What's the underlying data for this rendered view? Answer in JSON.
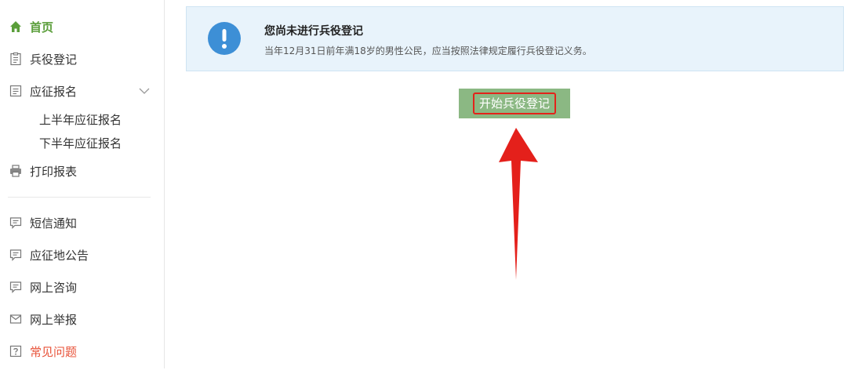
{
  "sidebar": {
    "items": [
      {
        "label": "首页",
        "icon": "home-icon"
      },
      {
        "label": "兵役登记",
        "icon": "clipboard-icon"
      },
      {
        "label": "应征报名",
        "icon": "form-icon"
      },
      {
        "label": "打印报表",
        "icon": "printer-icon"
      },
      {
        "label": "短信通知",
        "icon": "message-icon"
      },
      {
        "label": "应征地公告",
        "icon": "message-icon"
      },
      {
        "label": "网上咨询",
        "icon": "message-icon"
      },
      {
        "label": "网上举报",
        "icon": "mail-icon"
      },
      {
        "label": "常见问题",
        "icon": "question-icon"
      }
    ],
    "sub_items": [
      "上半年应征报名",
      "下半年应征报名"
    ]
  },
  "notice": {
    "title": "您尚未进行兵役登记",
    "desc": "当年12月31日前年满18岁的男性公民，应当按照法律规定履行兵役登记义务。"
  },
  "button": {
    "label": "开始兵役登记"
  },
  "colors": {
    "active": "#5a9e3a",
    "warn": "#e8533a",
    "button_bg": "#8bb883",
    "highlight": "#e3231a",
    "info_icon": "#3d8fd6",
    "notice_bg": "#e8f3fb"
  }
}
